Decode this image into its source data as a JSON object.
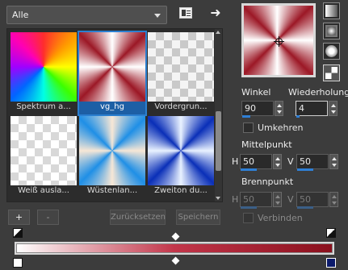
{
  "library": {
    "selected": "Alle"
  },
  "gradients": [
    {
      "label": "Spektrum a..."
    },
    {
      "label": "vg_hg"
    },
    {
      "label": "Vordergrun..."
    },
    {
      "label": "Weiß ausla..."
    },
    {
      "label": "Wüstenlan..."
    },
    {
      "label": "Zweiton du..."
    }
  ],
  "buttons": {
    "add": "+",
    "remove": "-",
    "reset": "Zurücksetzen",
    "save": "Speichern"
  },
  "settings": {
    "angle_label": "Winkel",
    "angle_value": "90",
    "repeat_label": "Wiederholungen",
    "repeat_value": "4",
    "invert_label": "Umkehren",
    "center_label": "Mittelpunkt",
    "center_h_label": "H",
    "center_h_value": "50",
    "center_v_label": "V",
    "center_v_value": "50",
    "focal_label": "Brennpunkt",
    "focal_h_label": "H",
    "focal_h_value": "50",
    "focal_v_label": "V",
    "focal_v_value": "50",
    "link_label": "Verbinden"
  },
  "colors": {
    "accent": "#2b7fd0",
    "ramp_start": "#ffffff",
    "ramp_end": "#8a101d"
  }
}
